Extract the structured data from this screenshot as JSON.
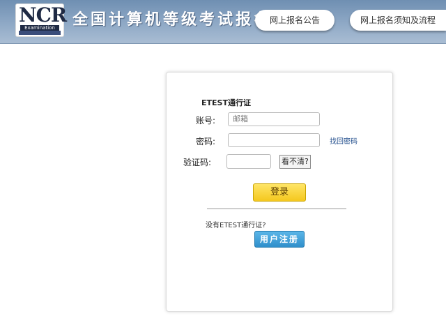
{
  "header": {
    "logo_text": "NCR",
    "logo_subtext": "Examination",
    "title": "全国计算机等级考试报名",
    "nav": [
      {
        "label": "网上报名公告"
      },
      {
        "label": "网上报名须知及流程"
      }
    ]
  },
  "login": {
    "title": "ETEST通行证",
    "username_label": "账号:",
    "username_placeholder": "邮箱",
    "password_label": "密码:",
    "forgot_password": "找回密码",
    "captcha_label": "验证码:",
    "captcha_refresh": "看不清?",
    "login_button": "登录",
    "no_account": "没有ETEST通行证?",
    "register_button": "用户注册"
  },
  "colors": {
    "header_bg": "#8fa9c6",
    "login_button": "#f4c81e",
    "register_button": "#2f8fcb",
    "link": "#1d4a8a"
  }
}
